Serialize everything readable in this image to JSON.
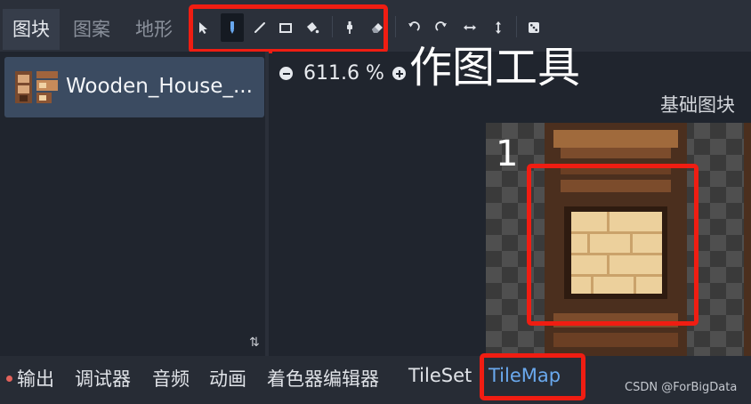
{
  "tabs": [
    "图块",
    "图案",
    "地形"
  ],
  "tools": [
    "select-icon",
    "paint-icon",
    "line-icon",
    "rect-icon",
    "bucket-icon",
    "picker-icon",
    "eraser-icon",
    "rotate-left-icon",
    "rotate-right-icon",
    "flip-h-icon",
    "flip-v-icon",
    "random-icon"
  ],
  "annotation": "作图工具",
  "tile_list": {
    "item_name": "Wooden_House_..."
  },
  "zoom": {
    "value": "611.6 %"
  },
  "atlas": {
    "section_title": "基础图块",
    "tile_index": "1"
  },
  "bottom_tabs": [
    "输出",
    "调试器",
    "音频",
    "动画",
    "着色器编辑器",
    "TileSet",
    "TileMap"
  ],
  "watermark": "CSDN @ForBigData",
  "colors": {
    "accent": "#6aa9ee",
    "highlight_red": "#f01d12",
    "selected_row": "#3b4b61",
    "error_dot": "#e3625b"
  }
}
